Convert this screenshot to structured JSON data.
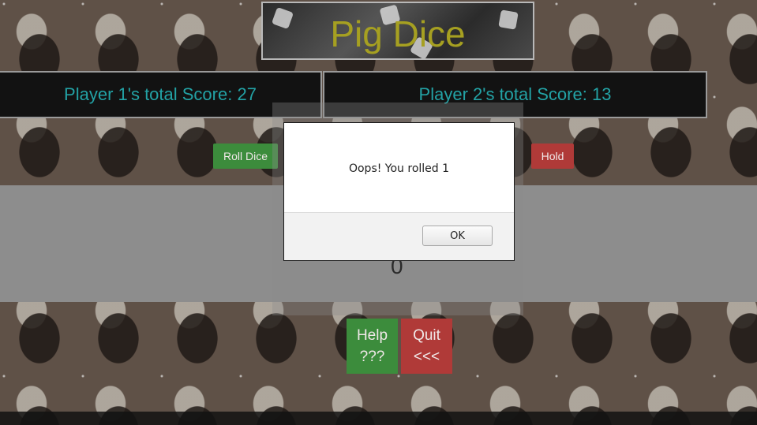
{
  "title": "Pig Dice",
  "scores": {
    "player1": "Player 1's total Score: 27",
    "player2": "Player 2's total Score: 13"
  },
  "buttons": {
    "roll": "Roll Dice",
    "hold": "Hold",
    "help_line1": "Help",
    "help_line2": "???",
    "quit_line1": "Quit",
    "quit_line2": "<<<"
  },
  "round_score": "0",
  "dialog": {
    "message": "Oops! You rolled 1",
    "ok_label": "OK"
  },
  "colors": {
    "title": "#a6a021",
    "score_text": "#23a2a5",
    "green_button": "#3c8c3c",
    "red_button": "#b03a38"
  }
}
